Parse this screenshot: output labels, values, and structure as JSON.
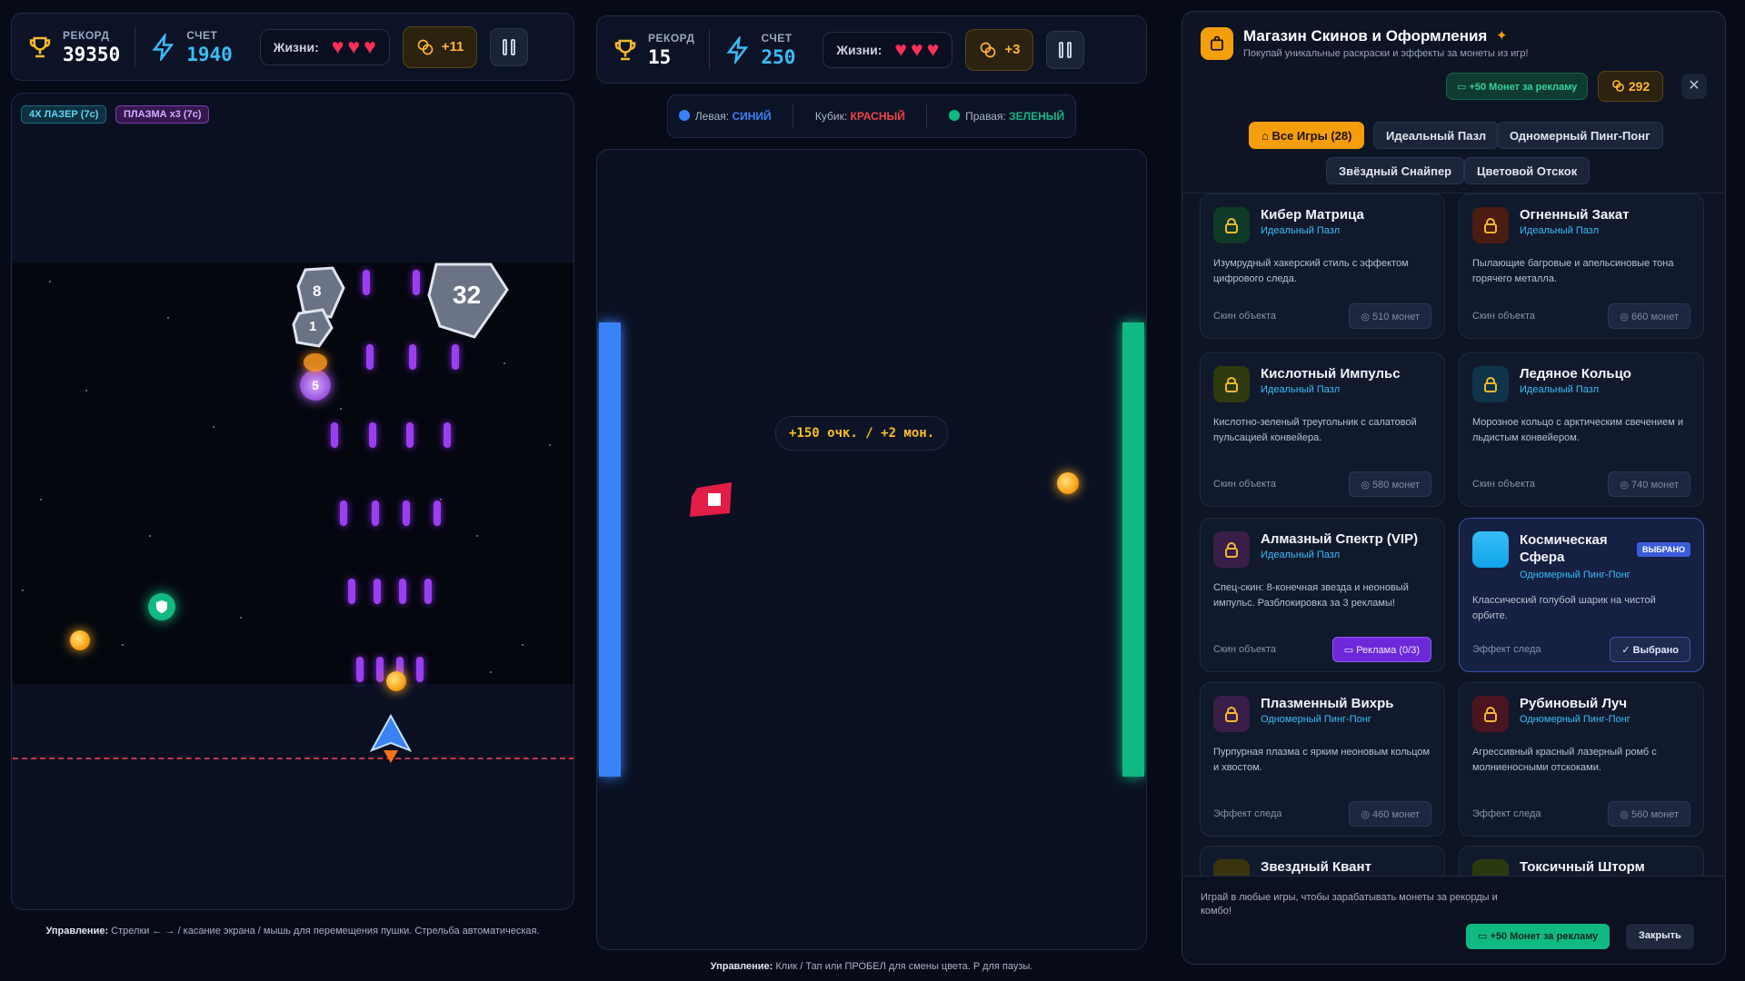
{
  "game1": {
    "hud": {
      "record_label": "РЕКОРД",
      "record_value": "39350",
      "score_label": "СЧЕТ",
      "score_value": "1940",
      "lives_label": "Жизни:",
      "lives": 3,
      "coins_gain": "+11"
    },
    "badges": [
      "4X ЛАЗЕР (7с)",
      "ПЛАЗМА x3 (7с)"
    ],
    "asteroids": [
      "8",
      "1",
      "32"
    ],
    "bomb_label": "5",
    "controls_label": "Управление:",
    "controls_text": "Стрелки ← → / касание экрана / мышь для перемещения пушки. Стрельба автоматическая."
  },
  "game2": {
    "hud": {
      "record_label": "РЕКОРД",
      "record_value": "15",
      "score_label": "СЧЕТ",
      "score_value": "250",
      "lives_label": "Жизни:",
      "lives": 3,
      "coins_gain": "+3"
    },
    "legend": {
      "left_label": "Левая:",
      "left_value": "СИНИЙ",
      "cube_label": "Кубик:",
      "cube_value": "КРАСНЫЙ",
      "right_label": "Правая:",
      "right_value": "ЗЕЛЕНЫЙ"
    },
    "popup": "+150 очк. / +2 мон.",
    "controls_label": "Управление:",
    "controls_text": "Клик / Тап или ПРОБЕЛ для смены цвета. P для паузы."
  },
  "shop": {
    "title": "Магазин Скинов и Оформления",
    "subtitle": "Покупай уникальные раскраски и эффекты за монеты из игр!",
    "ad_button": "+50 Монет за рекламу",
    "balance": "292",
    "tabs": [
      "Все Игры (28)",
      "Идеальный Пазл",
      "Одномерный Пинг-Понг",
      "Звёздный Снайпер",
      "Цветовой Отскок"
    ],
    "cards": [
      {
        "name": "Кибер Матрица",
        "game": "Идеальный Пазл",
        "desc": "Изумрудный хакерский стиль с эффектом цифрового следа.",
        "type": "Скин объекта",
        "action": "510 монет"
      },
      {
        "name": "Огненный Закат",
        "game": "Идеальный Пазл",
        "desc": "Пылающие багровые и апельсиновые тона горячего металла.",
        "type": "Скин объекта",
        "action": "660 монет"
      },
      {
        "name": "Кислотный Импульс",
        "game": "Идеальный Пазл",
        "desc": "Кислотно-зеленый треугольник с салатовой пульсацией конвейера.",
        "type": "Скин объекта",
        "action": "580 монет"
      },
      {
        "name": "Ледяное Кольцо",
        "game": "Идеальный Пазл",
        "desc": "Морозное кольцо с арктическим свечением и льдистым конвейером.",
        "type": "Скин объекта",
        "action": "740 монет"
      },
      {
        "name": "Алмазный Спектр (VIP)",
        "game": "Идеальный Пазл",
        "desc": "Спец-скин: 8-конечная звезда и неоновый импульс. Разблокировка за 3 рекламы!",
        "type": "Скин объекта",
        "action": "Реклама (0/3)"
      },
      {
        "name": "Космическая Сфера",
        "game": "Одномерный Пинг-Понг",
        "desc": "Классический голубой шарик на чистой орбите.",
        "type": "Эффект следа",
        "action": "Выбрано",
        "badge": "ВЫБРАНО"
      },
      {
        "name": "Плазменный Вихрь",
        "game": "Одномерный Пинг-Понг",
        "desc": "Пурпурная плазма с ярким неоновым кольцом и хвостом.",
        "type": "Эффект следа",
        "action": "460 монет"
      },
      {
        "name": "Рубиновый Луч",
        "game": "Одномерный Пинг-Понг",
        "desc": "Агрессивный красный лазерный ромб с молниеносными отскоками.",
        "type": "Эффект следа",
        "action": "560 монет"
      },
      {
        "name": "Звездный Квант"
      },
      {
        "name": "Токсичный Шторм"
      }
    ],
    "footer_text": "Играй в любые игры, чтобы зарабатывать монеты за рекорды и комбо!",
    "footer_ad": "+50 Монет за рекламу",
    "close": "Закрыть"
  }
}
